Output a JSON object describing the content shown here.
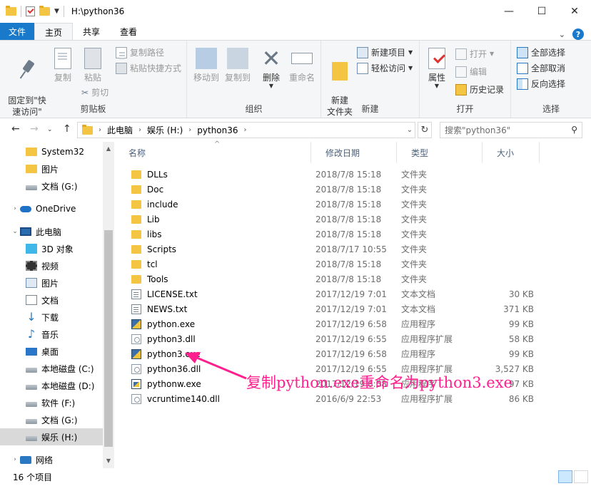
{
  "window": {
    "title": "H:\\python36",
    "controls": {
      "minimize": "—",
      "maximize": "☐",
      "close": "✕"
    }
  },
  "ribbon_tabs": [
    {
      "label": "文件"
    },
    {
      "label": "主页"
    },
    {
      "label": "共享"
    },
    {
      "label": "查看"
    }
  ],
  "ribbon": {
    "clipboard": {
      "label": "剪贴板",
      "pin": "固定到\"快\n速访问\"",
      "copy": "复制",
      "paste": "粘贴",
      "copy_path": "复制路径",
      "paste_shortcut": "粘贴快捷方式",
      "cut": "剪切"
    },
    "organize": {
      "label": "组织",
      "move_to": "移动到",
      "copy_to": "复制到",
      "delete": "删除",
      "rename": "重命名"
    },
    "new": {
      "label": "新建",
      "new_folder": "新建\n文件夹",
      "new_item": "新建项目",
      "easy_access": "轻松访问"
    },
    "open": {
      "label": "打开",
      "properties": "属性",
      "open": "打开",
      "edit": "编辑",
      "history": "历史记录"
    },
    "select": {
      "label": "选择",
      "select_all": "全部选择",
      "select_none": "全部取消",
      "invert": "反向选择"
    }
  },
  "address": {
    "segments": [
      "此电脑",
      "娱乐 (H:)",
      "python36"
    ],
    "search_placeholder": "搜索\"python36\""
  },
  "nav_pane": {
    "items": [
      {
        "label": "System32",
        "icon": "folder"
      },
      {
        "label": "图片",
        "icon": "folder"
      },
      {
        "label": "文档 (G:)",
        "icon": "drive"
      },
      {
        "label": "OneDrive",
        "icon": "cloud"
      },
      {
        "label": "此电脑",
        "icon": "pc"
      },
      {
        "label": "3D 对象",
        "icon": "obj3d"
      },
      {
        "label": "视频",
        "icon": "video"
      },
      {
        "label": "图片",
        "icon": "pics"
      },
      {
        "label": "文档",
        "icon": "docs"
      },
      {
        "label": "下载",
        "icon": "down"
      },
      {
        "label": "音乐",
        "icon": "music"
      },
      {
        "label": "桌面",
        "icon": "desk"
      },
      {
        "label": "本地磁盘 (C:)",
        "icon": "drive"
      },
      {
        "label": "本地磁盘 (D:)",
        "icon": "drive"
      },
      {
        "label": "软件 (F:)",
        "icon": "drive"
      },
      {
        "label": "文档 (G:)",
        "icon": "drive"
      },
      {
        "label": "娱乐 (H:)",
        "icon": "drive"
      },
      {
        "label": "网络",
        "icon": "net"
      }
    ]
  },
  "columns": {
    "name": "名称",
    "date": "修改日期",
    "type": "类型",
    "size": "大小"
  },
  "files": [
    {
      "name": "DLLs",
      "date": "2018/7/8 15:18",
      "type": "文件夹",
      "size": "",
      "icon": "folder"
    },
    {
      "name": "Doc",
      "date": "2018/7/8 15:18",
      "type": "文件夹",
      "size": "",
      "icon": "folder"
    },
    {
      "name": "include",
      "date": "2018/7/8 15:18",
      "type": "文件夹",
      "size": "",
      "icon": "folder"
    },
    {
      "name": "Lib",
      "date": "2018/7/8 15:18",
      "type": "文件夹",
      "size": "",
      "icon": "folder"
    },
    {
      "name": "libs",
      "date": "2018/7/8 15:18",
      "type": "文件夹",
      "size": "",
      "icon": "folder"
    },
    {
      "name": "Scripts",
      "date": "2018/7/17 10:55",
      "type": "文件夹",
      "size": "",
      "icon": "folder"
    },
    {
      "name": "tcl",
      "date": "2018/7/8 15:18",
      "type": "文件夹",
      "size": "",
      "icon": "folder"
    },
    {
      "name": "Tools",
      "date": "2018/7/8 15:18",
      "type": "文件夹",
      "size": "",
      "icon": "folder"
    },
    {
      "name": "LICENSE.txt",
      "date": "2017/12/19 7:01",
      "type": "文本文档",
      "size": "30 KB",
      "icon": "text"
    },
    {
      "name": "NEWS.txt",
      "date": "2017/12/19 7:01",
      "type": "文本文档",
      "size": "371 KB",
      "icon": "text"
    },
    {
      "name": "python.exe",
      "date": "2017/12/19 6:58",
      "type": "应用程序",
      "size": "99 KB",
      "icon": "exe"
    },
    {
      "name": "python3.dll",
      "date": "2017/12/19 6:55",
      "type": "应用程序扩展",
      "size": "58 KB",
      "icon": "dll"
    },
    {
      "name": "python3.exe",
      "date": "2017/12/19 6:58",
      "type": "应用程序",
      "size": "99 KB",
      "icon": "exe"
    },
    {
      "name": "python36.dll",
      "date": "2017/12/19 6:55",
      "type": "应用程序扩展",
      "size": "3,527 KB",
      "icon": "dll"
    },
    {
      "name": "pythonw.exe",
      "date": "2017/12/19 6:58",
      "type": "应用程序",
      "size": "97 KB",
      "icon": "exew"
    },
    {
      "name": "vcruntime140.dll",
      "date": "2016/6/9 22:53",
      "type": "应用程序扩展",
      "size": "86 KB",
      "icon": "dll"
    }
  ],
  "annotation": "复制python.exe重命名为python3.exe",
  "status": {
    "count": "16 个项目"
  },
  "colors": {
    "accent": "#1979ca",
    "annotation": "#ff1f8f",
    "selection": "#cce8ff"
  }
}
